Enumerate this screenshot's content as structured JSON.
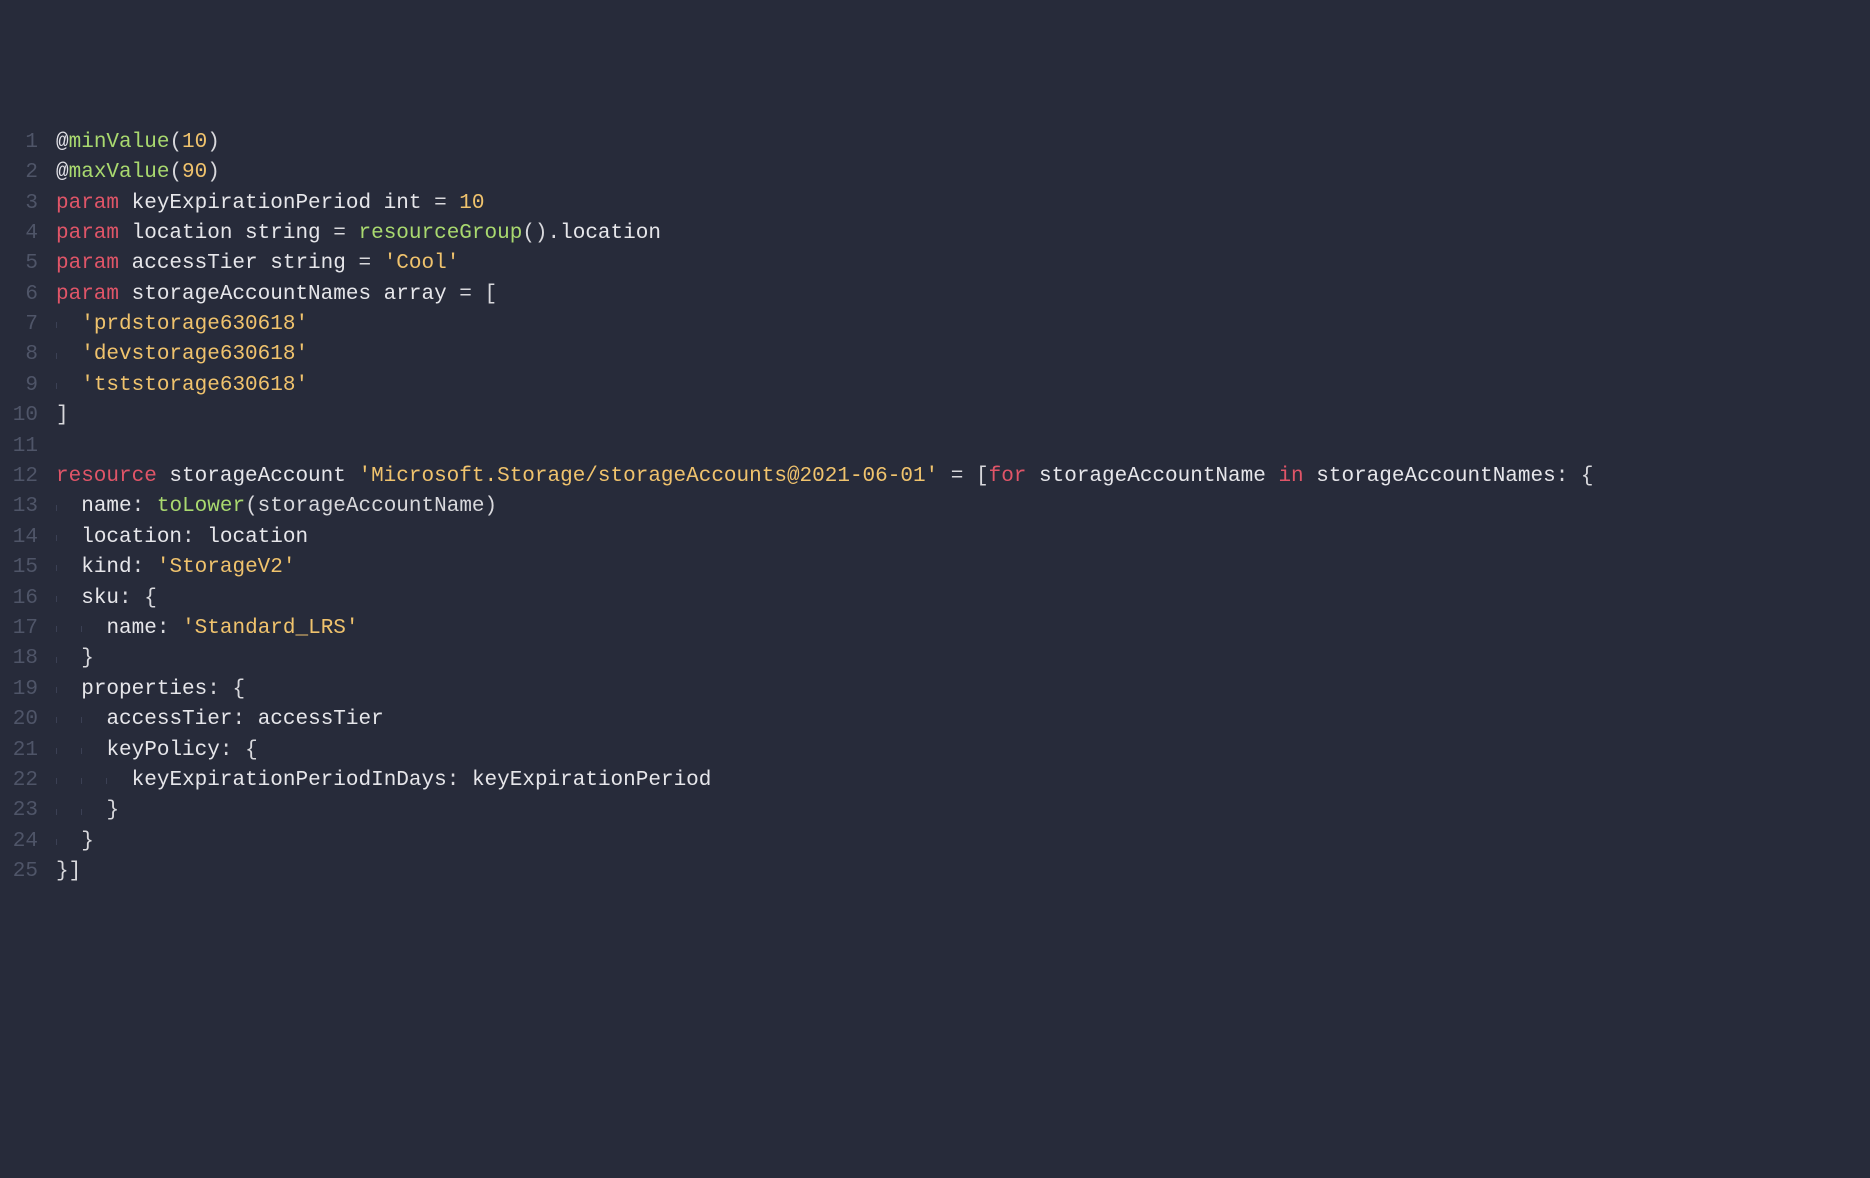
{
  "theme": {
    "background": "#272b3a",
    "gutter": "#4f5568",
    "default": "#e0e0e6",
    "keyword": "#e05568",
    "decorator": "#a9d96f",
    "function": "#a9d96f",
    "string": "#f0c36d",
    "number": "#f0c36d",
    "indent_guide": "#3b4054"
  },
  "line_numbers": [
    "1",
    "2",
    "3",
    "4",
    "5",
    "6",
    "7",
    "8",
    "9",
    "10",
    "11",
    "12",
    "13",
    "14",
    "15",
    "16",
    "17",
    "18",
    "19",
    "20",
    "21",
    "22",
    "23",
    "24",
    "25"
  ],
  "lines": [
    {
      "indent": 0,
      "tokens": [
        {
          "t": "@",
          "c": "at"
        },
        {
          "t": "minValue",
          "c": "deco"
        },
        {
          "t": "(",
          "c": "paren"
        },
        {
          "t": "10",
          "c": "num"
        },
        {
          "t": ")",
          "c": "paren"
        }
      ]
    },
    {
      "indent": 0,
      "tokens": [
        {
          "t": "@",
          "c": "at"
        },
        {
          "t": "maxValue",
          "c": "deco"
        },
        {
          "t": "(",
          "c": "paren"
        },
        {
          "t": "90",
          "c": "num"
        },
        {
          "t": ")",
          "c": "paren"
        }
      ]
    },
    {
      "indent": 0,
      "tokens": [
        {
          "t": "param",
          "c": "kw"
        },
        {
          "t": " keyExpirationPeriod ",
          "c": "ident"
        },
        {
          "t": "int",
          "c": "type"
        },
        {
          "t": " = ",
          "c": "op"
        },
        {
          "t": "10",
          "c": "num"
        }
      ]
    },
    {
      "indent": 0,
      "tokens": [
        {
          "t": "param",
          "c": "kw"
        },
        {
          "t": " location ",
          "c": "ident"
        },
        {
          "t": "string",
          "c": "type"
        },
        {
          "t": " = ",
          "c": "op"
        },
        {
          "t": "resourceGroup",
          "c": "fn"
        },
        {
          "t": "().",
          "c": "op"
        },
        {
          "t": "location",
          "c": "ident"
        }
      ]
    },
    {
      "indent": 0,
      "tokens": [
        {
          "t": "param",
          "c": "kw"
        },
        {
          "t": " accessTier ",
          "c": "ident"
        },
        {
          "t": "string",
          "c": "type"
        },
        {
          "t": " = ",
          "c": "op"
        },
        {
          "t": "'Cool'",
          "c": "str"
        }
      ]
    },
    {
      "indent": 0,
      "tokens": [
        {
          "t": "param",
          "c": "kw"
        },
        {
          "t": " storageAccountNames ",
          "c": "ident"
        },
        {
          "t": "array",
          "c": "type"
        },
        {
          "t": " = [",
          "c": "op"
        }
      ]
    },
    {
      "indent": 1,
      "tokens": [
        {
          "t": "'prdstorage630618'",
          "c": "str"
        }
      ]
    },
    {
      "indent": 1,
      "tokens": [
        {
          "t": "'devstorage630618'",
          "c": "str"
        }
      ]
    },
    {
      "indent": 1,
      "tokens": [
        {
          "t": "'tststorage630618'",
          "c": "str"
        }
      ]
    },
    {
      "indent": 0,
      "tokens": [
        {
          "t": "]",
          "c": "op"
        }
      ]
    },
    {
      "indent": 0,
      "tokens": []
    },
    {
      "indent": 0,
      "tokens": [
        {
          "t": "resource",
          "c": "kw"
        },
        {
          "t": " storageAccount ",
          "c": "ident"
        },
        {
          "t": "'Microsoft.Storage/storageAccounts@2021-06-01'",
          "c": "str"
        },
        {
          "t": " = [",
          "c": "op"
        },
        {
          "t": "for",
          "c": "kw"
        },
        {
          "t": " storageAccountName ",
          "c": "ident"
        },
        {
          "t": "in",
          "c": "kw"
        },
        {
          "t": " storageAccountNames",
          "c": "ident"
        },
        {
          "t": ": {",
          "c": "op"
        }
      ]
    },
    {
      "indent": 1,
      "tokens": [
        {
          "t": "name",
          "c": "prop"
        },
        {
          "t": ": ",
          "c": "op"
        },
        {
          "t": "toLower",
          "c": "fn"
        },
        {
          "t": "(storageAccountName)",
          "c": "paren"
        }
      ]
    },
    {
      "indent": 1,
      "tokens": [
        {
          "t": "location",
          "c": "prop"
        },
        {
          "t": ": ",
          "c": "op"
        },
        {
          "t": "location",
          "c": "ident"
        }
      ]
    },
    {
      "indent": 1,
      "tokens": [
        {
          "t": "kind",
          "c": "prop"
        },
        {
          "t": ": ",
          "c": "op"
        },
        {
          "t": "'StorageV2'",
          "c": "str"
        }
      ]
    },
    {
      "indent": 1,
      "tokens": [
        {
          "t": "sku",
          "c": "prop"
        },
        {
          "t": ": {",
          "c": "op"
        }
      ]
    },
    {
      "indent": 2,
      "tokens": [
        {
          "t": "name",
          "c": "prop"
        },
        {
          "t": ": ",
          "c": "op"
        },
        {
          "t": "'Standard_LRS'",
          "c": "str"
        }
      ]
    },
    {
      "indent": 1,
      "tokens": [
        {
          "t": "}",
          "c": "op"
        }
      ]
    },
    {
      "indent": 1,
      "tokens": [
        {
          "t": "properties",
          "c": "prop"
        },
        {
          "t": ": {",
          "c": "op"
        }
      ]
    },
    {
      "indent": 2,
      "tokens": [
        {
          "t": "accessTier",
          "c": "prop"
        },
        {
          "t": ": ",
          "c": "op"
        },
        {
          "t": "accessTier",
          "c": "ident"
        }
      ]
    },
    {
      "indent": 2,
      "tokens": [
        {
          "t": "keyPolicy",
          "c": "prop"
        },
        {
          "t": ": {",
          "c": "op"
        }
      ]
    },
    {
      "indent": 3,
      "tokens": [
        {
          "t": "keyExpirationPeriodInDays",
          "c": "prop"
        },
        {
          "t": ": ",
          "c": "op"
        },
        {
          "t": "keyExpirationPeriod",
          "c": "ident"
        }
      ]
    },
    {
      "indent": 2,
      "tokens": [
        {
          "t": "}",
          "c": "op"
        }
      ]
    },
    {
      "indent": 1,
      "tokens": [
        {
          "t": "}",
          "c": "op"
        }
      ]
    },
    {
      "indent": 0,
      "tokens": [
        {
          "t": "}]",
          "c": "op"
        }
      ]
    }
  ]
}
